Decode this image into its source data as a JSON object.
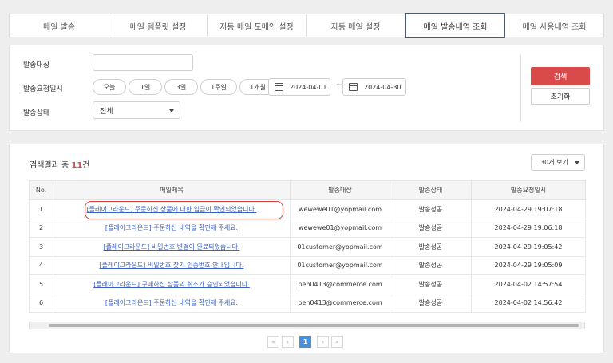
{
  "tabs": [
    {
      "label": "메일 발송"
    },
    {
      "label": "메일 템플릿 설정"
    },
    {
      "label": "자동 메일 도메인 설정"
    },
    {
      "label": "자동 메일 설정"
    },
    {
      "label": "메일 발송내역 조회",
      "active": true
    },
    {
      "label": "메일 사용내역 조회"
    }
  ],
  "search": {
    "recipient_label": "발송대상",
    "recipient_value": "",
    "date_label": "발송요청일시",
    "quick_ranges": [
      "오늘",
      "1일",
      "3일",
      "1주일",
      "1개월"
    ],
    "date_from": "2024-04-01",
    "date_to": "2024-04-30",
    "date_separator": "~",
    "status_label": "발송상태",
    "status_value": "전체",
    "search_button": "검색",
    "reset_button": "초기화"
  },
  "results": {
    "summary_prefix": "검색결과 총",
    "count": "11",
    "count_unit": "건",
    "per_page": "30개 보기",
    "columns": [
      "No.",
      "메일제목",
      "발송대상",
      "발송상태",
      "발송요청일시"
    ],
    "rows": [
      {
        "no": "1",
        "subject": "[플레이그라운드] 주문하신 상품에 대한 입금이 확인되었습니다.",
        "recipient": "wewewe01@yopmail.com",
        "status": "발송성공",
        "requested_at": "2024-04-29 19:07:18"
      },
      {
        "no": "2",
        "subject": "[플레이그라운드] 주문하신 내역을 확인해 주세요.",
        "recipient": "wewewe01@yopmail.com",
        "status": "발송성공",
        "requested_at": "2024-04-29 19:06:18"
      },
      {
        "no": "3",
        "subject": "[플레이그라운드] 비밀번호 변경이 완료되었습니다.",
        "recipient": "01customer@yopmail.com",
        "status": "발송성공",
        "requested_at": "2024-04-29 19:05:42"
      },
      {
        "no": "4",
        "subject": "[플레이그라운드] 비밀번호 찾기 인증번호 안내입니다.",
        "recipient": "01customer@yopmail.com",
        "status": "발송성공",
        "requested_at": "2024-04-29 19:05:09"
      },
      {
        "no": "5",
        "subject": "[플레이그라운드] 구매하신 상품의 취소가 승인되었습니다.",
        "recipient": "peh0413@commerce.com",
        "status": "발송성공",
        "requested_at": "2024-04-02 14:57:54"
      },
      {
        "no": "6",
        "subject": "[플레이그라운드] 주문하신 내역을 확인해 주세요.",
        "recipient": "peh0413@commerce.com",
        "status": "발송성공",
        "requested_at": "2024-04-02 14:56:42"
      }
    ]
  },
  "pagination": {
    "first": "«",
    "prev": "‹",
    "current": "1",
    "next": "›",
    "last": "»"
  },
  "colors": {
    "accent": "#d94b4b",
    "link": "#3b5fc4",
    "page_current": "#4a90d9",
    "highlight": "#e03c3c"
  }
}
